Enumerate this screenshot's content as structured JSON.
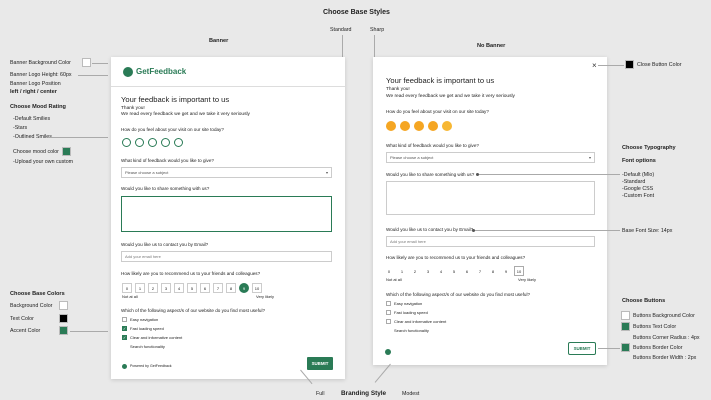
{
  "header": {
    "title": "Choose Base Styles",
    "banner": "Banner",
    "standard": "Standard",
    "sharp": "Sharp",
    "no_banner": "No Banner"
  },
  "left": {
    "banner_bg": "Banner Background Color",
    "logo_height": "Banner Logo Height: 60px",
    "logo_position": "Banner Logo Position",
    "position_options": "left / right / center",
    "mood_title": "Choose Mood Rating",
    "mood_options": [
      "-Default Smilies",
      "-Stars",
      "-Outlined Smiles"
    ],
    "mood_color": "Choose mood color",
    "upload": "-Upload your own custom",
    "base_colors_title": "Choose Base Colors",
    "bg_color": "Background Color",
    "text_color": "Text Color",
    "accent_color": "Accent Color"
  },
  "right": {
    "close_color": "Close Button Color",
    "typography_title": "Choose Typography",
    "font_options_title": "Font options",
    "font_options": [
      "-Default (Mlo)",
      "-Standard",
      "-Google CSS",
      "-Custom Font"
    ],
    "base_font": "Base Font Size: 14px",
    "buttons_title": "Choose Buttons",
    "buttons": [
      "Buttons Background Color",
      "Buttons Text Color",
      "Buttons Corner Radius : 4px",
      "Buttons Border Color",
      "Buttons Border Width : 2px"
    ]
  },
  "footer": {
    "full": "Full",
    "branding": "Branding Style",
    "modest": "Modest"
  },
  "form": {
    "logo": "GetFeedback",
    "title": "Your feedback is important to us",
    "thanks": "Thank you!",
    "read": "We read every feedback we get and we take it very seriously",
    "q_visit": "How do you feel about your visit on our site today?",
    "q_kind": "What kind of feedback would you like to give?",
    "select_placeholder": "Please choose a subject",
    "q_share": "Would you like to share something with us?",
    "q_contact": "Would you like us to contact you by Email?",
    "email_placeholder": "Add your email here",
    "q_recommend": "How likely are you to recommend us to your friends and colleagues?",
    "nps": [
      "0",
      "1",
      "2",
      "3",
      "4",
      "5",
      "6",
      "7",
      "8",
      "9",
      "10"
    ],
    "nps_low": "Not at all",
    "nps_high": "Very likely",
    "q_aspects": "Which of the following aspect/s of our website do you find most useful?",
    "options": [
      "Easy navigation",
      "Fast loading speed",
      "Clear and informative content",
      "Search functionality"
    ],
    "submit": "SUBMIT",
    "powered": "Powered by GetFeedback",
    "close": "×"
  },
  "colors": {
    "accent": "#2a7b56",
    "black": "#000000",
    "white": "#ffffff",
    "background": "#e9e9e9"
  }
}
